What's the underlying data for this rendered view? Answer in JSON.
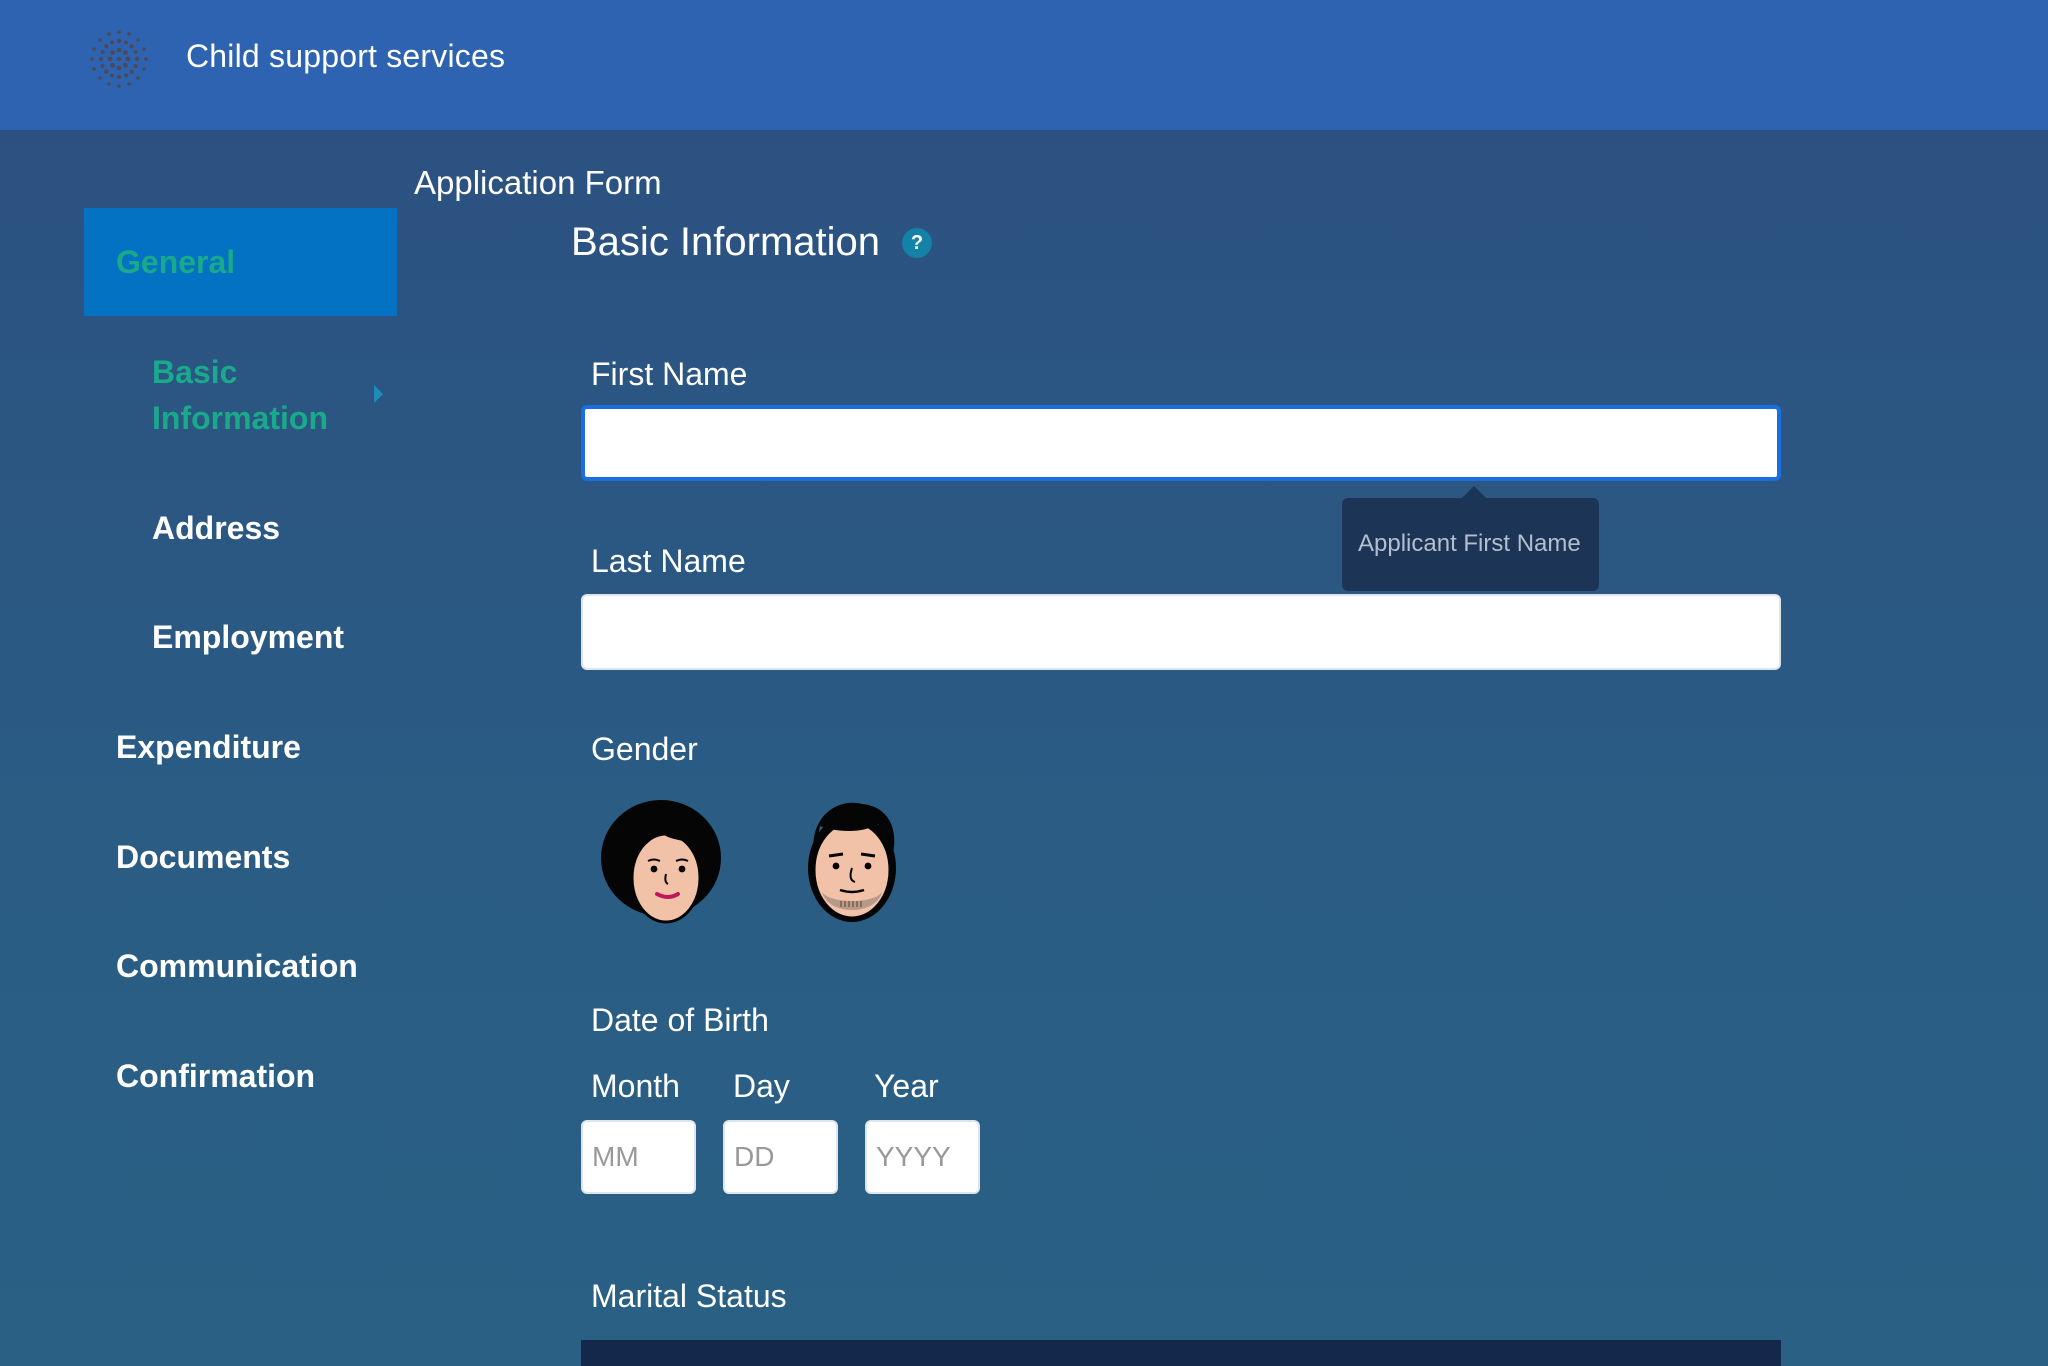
{
  "header": {
    "title": "Child support services",
    "logo_icon": "dotted-circle-logo"
  },
  "page": {
    "form_title": "Application Form",
    "section_title": "Basic Information",
    "help_icon": "question-mark-icon",
    "help_symbol": "?"
  },
  "sidebar": {
    "items": [
      {
        "label": "General",
        "state": "active"
      },
      {
        "label": "Basic Information",
        "state": "current-subitem"
      },
      {
        "label": "Address",
        "state": "subitem"
      },
      {
        "label": "Employment",
        "state": "subitem"
      },
      {
        "label": "Expenditure",
        "state": "item"
      },
      {
        "label": "Documents",
        "state": "item"
      },
      {
        "label": "Communication",
        "state": "item"
      },
      {
        "label": "Confirmation",
        "state": "item"
      }
    ]
  },
  "form": {
    "first_name": {
      "label": "First Name",
      "value": "",
      "tooltip": "Applicant First Name"
    },
    "last_name": {
      "label": "Last Name",
      "value": ""
    },
    "gender": {
      "label": "Gender",
      "options": [
        {
          "name": "female",
          "icon": "female-avatar-icon"
        },
        {
          "name": "male",
          "icon": "male-avatar-icon"
        }
      ]
    },
    "dob": {
      "label": "Date of Birth",
      "month": {
        "label": "Month",
        "placeholder": "MM"
      },
      "day": {
        "label": "Day",
        "placeholder": "DD"
      },
      "year": {
        "label": "Year",
        "placeholder": "YYYY"
      }
    },
    "marital_status": {
      "label": "Marital Status"
    }
  },
  "colors": {
    "header_bg": "#2d63b0",
    "accent_green": "#19a98b",
    "active_nav_bg": "#0372c2",
    "focus_border": "#1a6fe0"
  }
}
